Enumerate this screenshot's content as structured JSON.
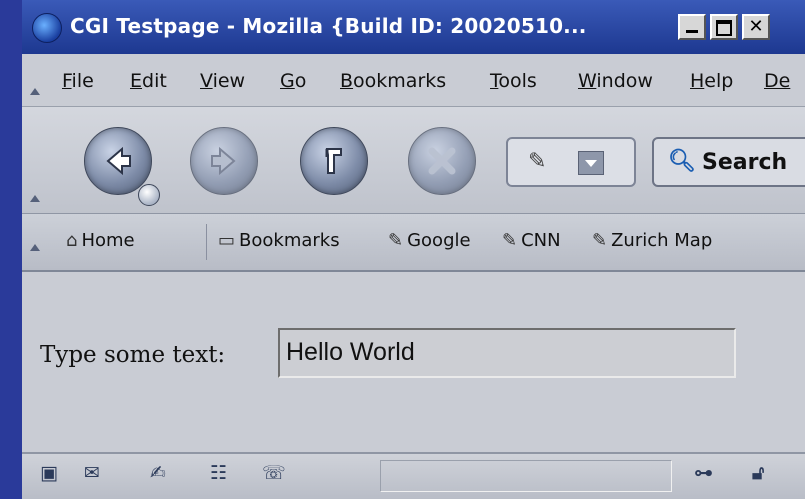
{
  "window": {
    "title": "CGI Testpage - Mozilla {Build ID: 20020510..."
  },
  "menu": {
    "items": [
      {
        "first": "F",
        "rest": "ile"
      },
      {
        "first": "E",
        "rest": "dit"
      },
      {
        "first": "V",
        "rest": "iew"
      },
      {
        "first": "G",
        "rest": "o"
      },
      {
        "first": "B",
        "rest": "ookmarks"
      },
      {
        "first": "T",
        "rest": "ools"
      },
      {
        "first": "W",
        "rest": "indow"
      },
      {
        "first": "H",
        "rest": "elp"
      },
      {
        "first": "De",
        "rest": ""
      }
    ]
  },
  "navbar": {
    "search_label": "Search"
  },
  "personal_toolbar": {
    "home": "Home",
    "bookmarks": "Bookmarks",
    "links": [
      "Google",
      "CNN",
      "Zurich Map"
    ]
  },
  "content": {
    "field_label": "Type some text:",
    "field_value": "Hello World"
  }
}
